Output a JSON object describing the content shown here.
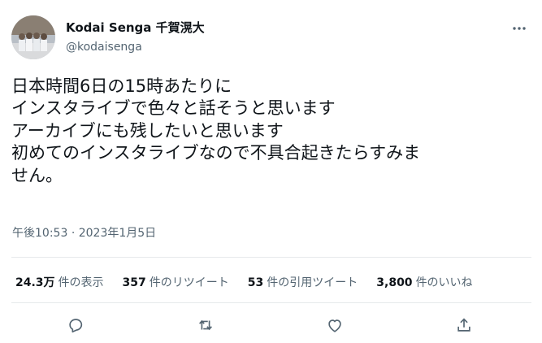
{
  "tweet": {
    "author": {
      "display_name": "Kodai Senga 千賀滉大",
      "handle": "@kodaisenga"
    },
    "text_lines": [
      "日本時間6日の15時あたりに",
      "インスタライブで色々と話そうと思います",
      "アーカイブにも残したいと思います",
      "初めてのインスタライブなので不具合起きたらすみま",
      "せん。"
    ],
    "time": "午後10:53",
    "separator": "·",
    "date": "2023年1月5日",
    "stats": [
      {
        "value": "24.3万",
        "label": "件の表示"
      },
      {
        "value": "357",
        "label": "件のリツイート"
      },
      {
        "value": "53",
        "label": "件の引用ツイート"
      },
      {
        "value": "3,800",
        "label": "件のいいね"
      }
    ],
    "actions": [
      "reply-icon",
      "retweet-icon",
      "like-icon",
      "share-icon"
    ]
  },
  "colors": {
    "text": "#0f1419",
    "secondary": "#536471",
    "divider": "#e6e9eb"
  }
}
